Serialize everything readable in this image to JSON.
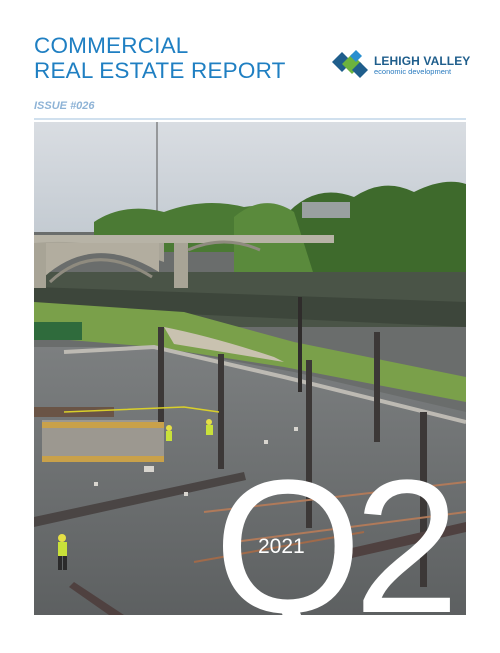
{
  "header": {
    "title_line1": "COMMERCIAL",
    "title_line2": "REAL ESTATE REPORT",
    "issue": "ISSUE #026"
  },
  "logo": {
    "name": "LEHIGH VALLEY",
    "tagline": "economic development"
  },
  "cover": {
    "year": "2021",
    "quarter": "Q2"
  },
  "colors": {
    "title_blue": "#1f7fc2",
    "issue_blue": "#8eb3d6",
    "logo_navy": "#1f5e8c",
    "logo_green": "#6cb33e"
  }
}
